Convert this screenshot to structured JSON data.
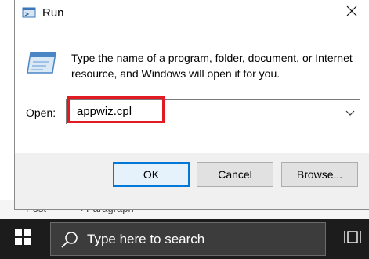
{
  "background": {
    "breadcrumb_left": "Post",
    "breadcrumb_sep": "›",
    "breadcrumb_right": "Paragraph"
  },
  "dialog": {
    "title": "Run",
    "icons": {
      "title": "run-icon",
      "close": "close-icon",
      "main": "run-app-icon"
    },
    "description": "Type the name of a program, folder, document, or Internet resource, and Windows will open it for you.",
    "open_label": "Open:",
    "open_value": "appwiz.cpl",
    "buttons": {
      "ok": "OK",
      "cancel": "Cancel",
      "browse": "Browse..."
    }
  },
  "taskbar": {
    "search_placeholder": "Type here to search",
    "icons": {
      "start": "windows-logo-icon",
      "search": "search-icon",
      "task_view": "task-view-icon"
    }
  },
  "colors": {
    "highlight": "#e01b24",
    "focus": "#0078d7",
    "taskbar": "#1c1c1c"
  }
}
